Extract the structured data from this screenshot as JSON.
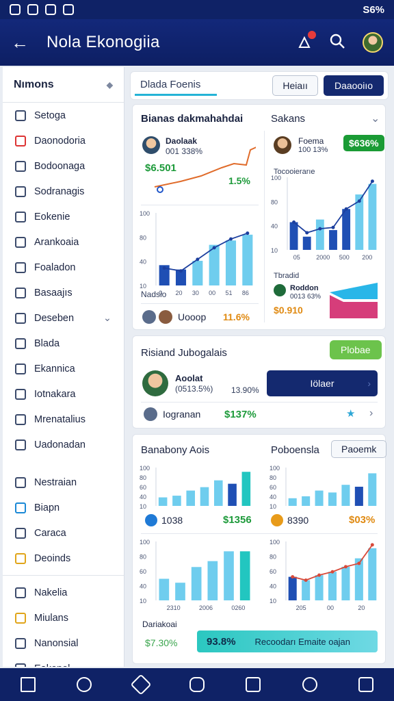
{
  "status": {
    "right": "S6%"
  },
  "appbar": {
    "title": "Nola Ekonogiia",
    "back": "←"
  },
  "sidebar": {
    "header": "Nımons",
    "items": [
      {
        "label": "Setoga",
        "tone": ""
      },
      {
        "label": "Daonodoria",
        "tone": "red"
      },
      {
        "label": "Bodoonaga",
        "tone": ""
      },
      {
        "label": "Sodranagis",
        "tone": ""
      },
      {
        "label": "Eokenie",
        "tone": ""
      },
      {
        "label": "Arankoaia",
        "tone": ""
      },
      {
        "label": "Foaladon",
        "tone": ""
      },
      {
        "label": "Basaajıs",
        "tone": ""
      },
      {
        "label": "Deseben",
        "tone": "",
        "chevron": true
      },
      {
        "label": "Blada",
        "tone": ""
      },
      {
        "label": "Ekannica",
        "tone": ""
      },
      {
        "label": "Iotnakara",
        "tone": ""
      },
      {
        "label": "Mrenatalius",
        "tone": ""
      },
      {
        "label": "Uadonadan",
        "tone": ""
      }
    ],
    "items2": [
      {
        "label": "Nestraian",
        "tone": ""
      },
      {
        "label": "Biapn",
        "tone": "blue"
      },
      {
        "label": "Caraca",
        "tone": ""
      },
      {
        "label": "Deoinds",
        "tone": "gold"
      }
    ],
    "items3": [
      {
        "label": "Nakelia",
        "tone": ""
      },
      {
        "label": "Miulans",
        "tone": "gold"
      },
      {
        "label": "Nanonsial",
        "tone": ""
      },
      {
        "label": "Eakopol",
        "tone": ""
      }
    ]
  },
  "toolbar": {
    "search": "Dlada Foenis",
    "btn1": "Heiaıı",
    "btn2": "Daaooiıo"
  },
  "card1": {
    "title": "Bianas dakmahahdai",
    "right_title": "Sakans",
    "p1_name": "Daolaak",
    "p1_sub": "001 338%",
    "p1_value": "$6.501",
    "p1_pct": "1.5%",
    "p2_name": "Foema",
    "p2_sub": "100 13%",
    "p2_badge": "$636%",
    "left_chart_caption": "Nadsio",
    "right_chart_title": "Tocooierarıe",
    "right_chart_caption": "Tbradid",
    "foot_left_name": "Uooop",
    "foot_left_pct": "11.6%",
    "foot_right_name": "Roddon",
    "foot_right_sub": "0013 63%",
    "foot_right_value": "$0.910"
  },
  "card2": {
    "title": "Risiand Jubogalais",
    "btn": "Plobae",
    "person_name": "Aoolat",
    "person_sub": "(0513.5%)",
    "person_value": "13.90%",
    "blue_btn": "Iölaer",
    "row_name": "Iogranan",
    "row_value": "$137%"
  },
  "card3": {
    "title_left": "Banabony Aois",
    "title_right": "Poboensla",
    "btn": "Paoemk",
    "row_left_value": "1038",
    "row_left_num": "$1356",
    "row_right_value": "8390",
    "row_right_pct": "$03%",
    "foot_label": "Dariakoai",
    "foot_left": "$7.30%",
    "foot_bar_pct": "93.8%",
    "foot_bar_text": "Recoodarı Emaite oajan"
  },
  "chart_data": [
    {
      "type": "bar",
      "name": "card1-left",
      "categories": [
        "1",
        "3",
        "5",
        "7",
        "9",
        "10"
      ],
      "values": [
        28,
        22,
        34,
        56,
        62,
        70
      ],
      "line": [
        24,
        20,
        36,
        52,
        64,
        72
      ],
      "ylim": [
        0,
        100
      ],
      "yticks": [
        "100",
        "80",
        "40",
        "10"
      ],
      "xticks": [
        "0",
        "20",
        "30",
        "00",
        "51",
        "86"
      ]
    },
    {
      "type": "bar",
      "name": "card1-right",
      "categories": [
        "1",
        "2",
        "3",
        "4",
        "5",
        "6",
        "7"
      ],
      "values": [
        42,
        20,
        46,
        30,
        62,
        84,
        100
      ],
      "line": [
        42,
        26,
        32,
        34,
        62,
        74,
        104
      ],
      "ylim": [
        0,
        110
      ],
      "yticks": [
        "100",
        "80",
        "40",
        "10"
      ],
      "xticks": [
        "05",
        "2000",
        "500",
        "200"
      ]
    },
    {
      "type": "bar",
      "name": "card3-top-left",
      "values": [
        10,
        12,
        18,
        22,
        30,
        26,
        40
      ],
      "ylim": [
        0,
        45
      ],
      "yticks": [
        "100",
        "80",
        "60",
        "40",
        "10"
      ]
    },
    {
      "type": "bar",
      "name": "card3-top-right",
      "values": [
        8,
        10,
        16,
        14,
        22,
        20,
        34
      ],
      "ylim": [
        0,
        40
      ],
      "yticks": [
        "100",
        "80",
        "60",
        "40",
        "10"
      ]
    },
    {
      "type": "bar",
      "name": "card3-bottom-left",
      "values": [
        22,
        18,
        34,
        40,
        50,
        50
      ],
      "ylim": [
        0,
        60
      ],
      "yticks": [
        "100",
        "80",
        "60",
        "40",
        "10"
      ],
      "xticks": [
        "2310",
        "2006",
        "0260"
      ]
    },
    {
      "type": "bar",
      "name": "card3-bottom-right",
      "values": [
        28,
        24,
        30,
        34,
        40,
        50,
        62
      ],
      "line": [
        28,
        24,
        30,
        34,
        40,
        44,
        66
      ],
      "ylim": [
        0,
        70
      ],
      "yticks": [
        "100",
        "80",
        "60",
        "40",
        "10"
      ],
      "xticks": [
        "205",
        "00",
        "20"
      ]
    }
  ]
}
